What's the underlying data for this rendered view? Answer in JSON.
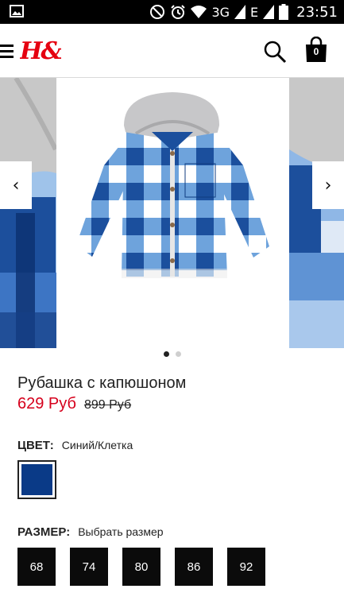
{
  "status_bar": {
    "network": "3G",
    "network2": "E",
    "time": "23:51"
  },
  "header": {
    "logo_text": "H&M",
    "brand_color": "#e50010",
    "cart_count": "0"
  },
  "gallery": {
    "prev_label": "‹",
    "next_label": "›",
    "slide_count": 2,
    "active_slide": 1
  },
  "product": {
    "title": "Рубашка с капюшоном",
    "price": "629 Руб",
    "old_price": "899 Руб",
    "price_color": "#d6001c"
  },
  "color": {
    "label": "ЦВЕТ:",
    "value": "Синий/Клетка",
    "swatch_color": "#0a3a87"
  },
  "size": {
    "label": "РАЗМЕР:",
    "placeholder": "Выбрать размер",
    "options": [
      "68",
      "74",
      "80",
      "86",
      "92"
    ]
  }
}
